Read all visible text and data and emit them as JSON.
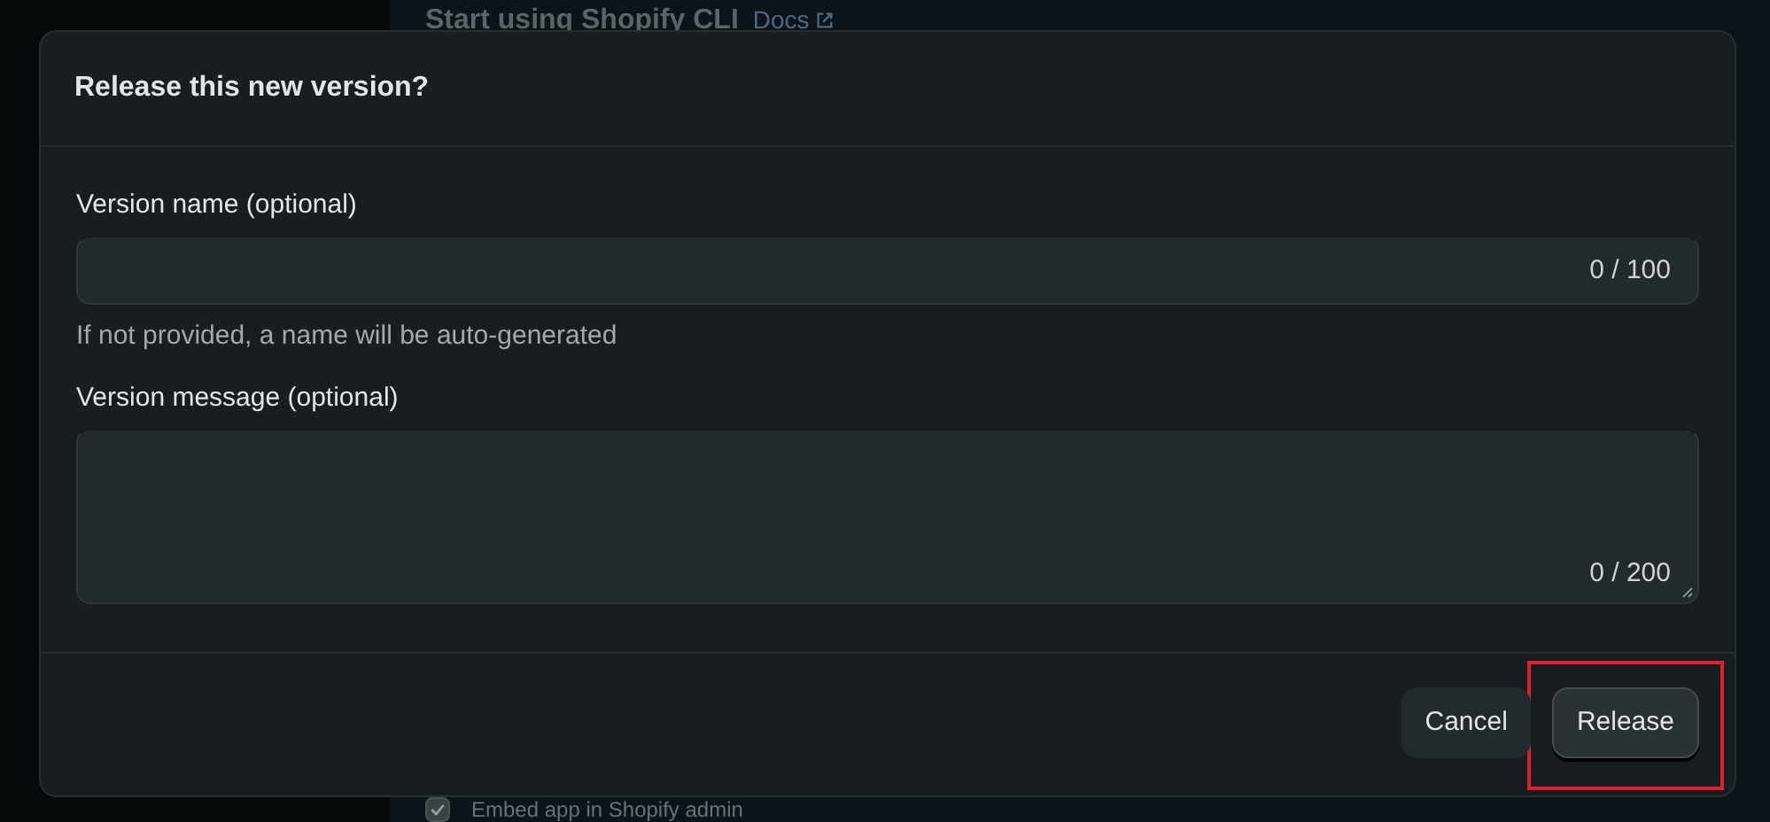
{
  "background": {
    "heading": "Start using Shopify CLI",
    "docs_link": "Docs",
    "embed_option": {
      "label": "Embed app in Shopify admin",
      "checked": true
    }
  },
  "dialog": {
    "title": "Release this new version?",
    "fields": [
      {
        "kind": "input",
        "label": "Version name (optional)",
        "counter": "0 / 100",
        "help": "If not provided, a name will be auto-generated"
      },
      {
        "kind": "textarea",
        "label": "Version message (optional)",
        "counter": "0 / 200"
      }
    ],
    "buttons": [
      {
        "label": "Cancel",
        "kind": "secondary",
        "highlighted": false
      },
      {
        "label": "Release",
        "kind": "primary",
        "highlighted": true
      }
    ]
  }
}
